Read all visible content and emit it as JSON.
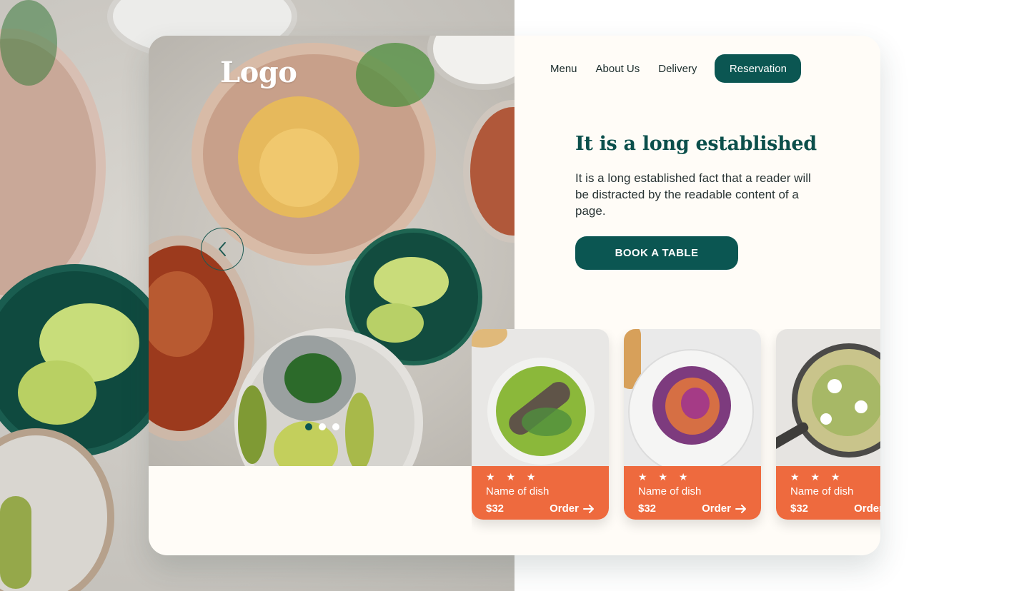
{
  "brand": {
    "logo_text": "Logo"
  },
  "nav": {
    "items": [
      {
        "label": "Menu"
      },
      {
        "label": "About Us"
      },
      {
        "label": "Delivery"
      }
    ],
    "cta_label": "Reservation"
  },
  "hero": {
    "headline": "It is a long established",
    "body": "It is a long established fact that a reader will be distracted by the readable content of a page.",
    "cta_label": "BOOK A TABLE",
    "prev_icon": "chevron-left-icon",
    "slider": {
      "total": 3,
      "active": 1
    }
  },
  "dishes": [
    {
      "stars": "★ ★ ★",
      "rating": 3,
      "name": "Name of dish",
      "price": "$32",
      "order_label": "Order"
    },
    {
      "stars": "★ ★ ★",
      "rating": 3,
      "name": "Name of dish",
      "price": "$32",
      "order_label": "Order"
    },
    {
      "stars": "★ ★ ★",
      "rating": 3,
      "name": "Name of dish",
      "price": "$32",
      "order_label": "Order"
    }
  ],
  "colors": {
    "primary": "#0b5652",
    "accent": "#ee6a3e",
    "card_bg": "#fffcf7",
    "headline": "#0b4f4b"
  }
}
